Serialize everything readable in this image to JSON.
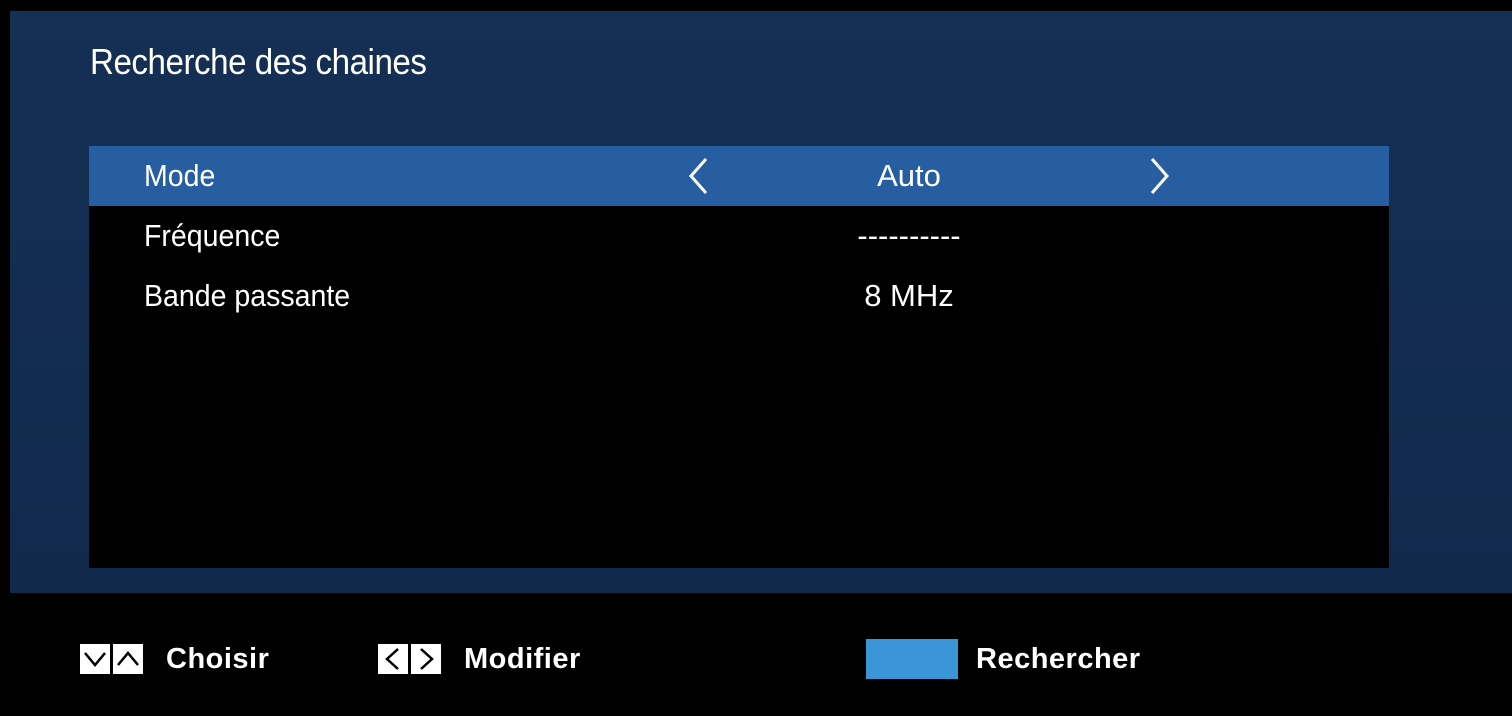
{
  "dialog": {
    "title": "Recherche des chaines"
  },
  "settings": [
    {
      "label": "Mode",
      "value": "Auto",
      "selected": true
    },
    {
      "label": "Fréquence",
      "value": "----------",
      "selected": false
    },
    {
      "label": "Bande passante",
      "value": "8 MHz",
      "selected": false
    }
  ],
  "footer": {
    "choose_label": "Choisir",
    "modify_label": "Modifier",
    "search_label": "Rechercher",
    "search_key_color": "#3a96d6"
  },
  "colors": {
    "dialog_bg": "#152f55",
    "selected_row": "#275da1",
    "panel_bg": "#000000"
  },
  "icons": {
    "selected_row_left": "chevron-left-icon",
    "selected_row_right": "chevron-right-icon",
    "choose_keys": [
      "chevron-down-key-icon",
      "chevron-up-key-icon"
    ],
    "modify_keys": [
      "chevron-left-key-icon",
      "chevron-right-key-icon"
    ],
    "search_key": "blue-key-icon"
  }
}
